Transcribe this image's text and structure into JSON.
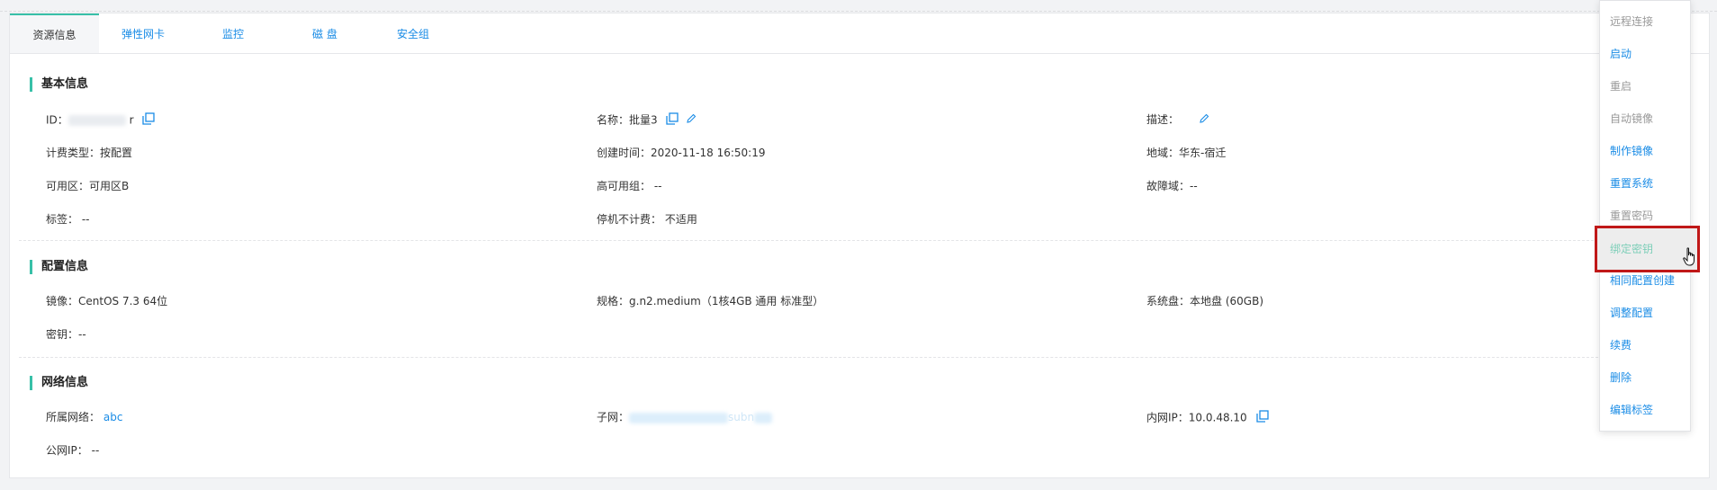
{
  "tabs": [
    "资源信息",
    "弹性网卡",
    "监控",
    "磁 盘",
    "安全组"
  ],
  "sections": {
    "basic": "基本信息",
    "config": "配置信息",
    "network": "网络信息"
  },
  "basic": {
    "id_label": "ID：",
    "id_suffix": "r",
    "name_label": "名称：",
    "name_value": "批量3",
    "desc_label": "描述：",
    "billing_label": "计费类型：",
    "billing_value": "按配置",
    "created_label": "创建时间：",
    "created_value": "2020-11-18 16:50:19",
    "region_label": "地域：",
    "region_value": "华东-宿迁",
    "zone_label": "可用区：",
    "zone_value": "可用区B",
    "ha_label": "高可用组：",
    "ha_value": "--",
    "fault_label": "故障域：",
    "fault_value": "--",
    "tags_label": "标签：",
    "tags_value": "--",
    "stopbill_label": "停机不计费：",
    "stopbill_value": "不适用"
  },
  "config": {
    "image_label": "镜像：",
    "image_value": "CentOS 7.3 64位",
    "spec_label": "规格：",
    "spec_value": "g.n2.medium（1核4GB 通用 标准型）",
    "sysdisk_label": "系统盘：",
    "sysdisk_value": "本地盘 (60GB)",
    "key_label": "密钥：",
    "key_value": "--"
  },
  "network": {
    "vpc_label": "所属网络：",
    "vpc_value": "abc",
    "subnet_label": "子网：",
    "subnet_partial": "subn",
    "privip_label": "内网IP：",
    "privip_value": "10.0.48.10",
    "pubip_label": "公网IP：",
    "pubip_value": "--"
  },
  "menu": [
    {
      "label": "远程连接",
      "state": "disabled"
    },
    {
      "label": "启动",
      "state": "enabled"
    },
    {
      "label": "重启",
      "state": "disabled"
    },
    {
      "label": "自动镜像",
      "state": "disabled"
    },
    {
      "label": "制作镜像",
      "state": "enabled"
    },
    {
      "label": "重置系统",
      "state": "enabled"
    },
    {
      "label": "重置密码",
      "state": "disabled"
    },
    {
      "label": "绑定密钥",
      "state": "highlighted"
    },
    {
      "label": "相同配置创建",
      "state": "enabled"
    },
    {
      "label": "调整配置",
      "state": "enabled"
    },
    {
      "label": "续费",
      "state": "enabled"
    },
    {
      "label": "删除",
      "state": "enabled"
    },
    {
      "label": "编辑标签",
      "state": "enabled"
    }
  ],
  "colors": {
    "accent": "#38c0a8",
    "link": "#1a8ce6",
    "highlight_border": "#c01818"
  }
}
